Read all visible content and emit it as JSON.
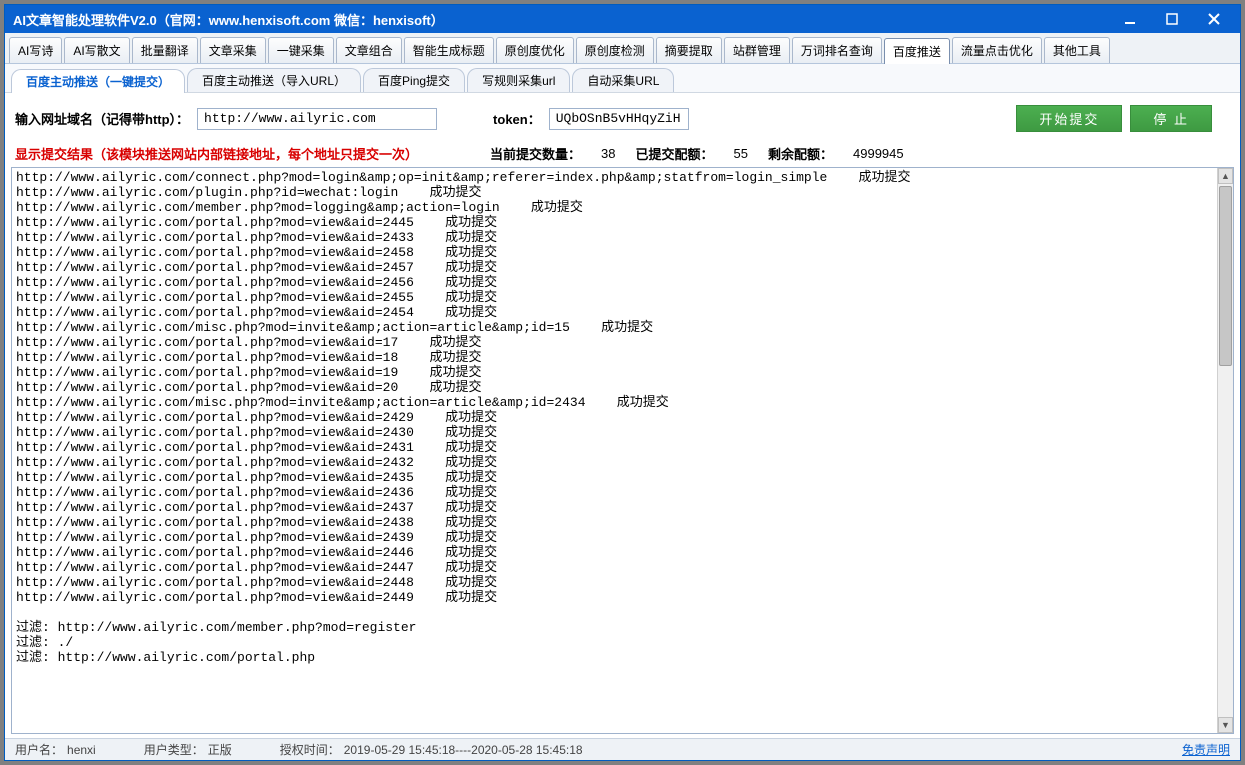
{
  "window": {
    "title": "AI文章智能处理软件V2.0（官网：www.henxisoft.com  微信：henxisoft）"
  },
  "main_tabs": [
    "AI写诗",
    "AI写散文",
    "批量翻译",
    "文章采集",
    "一键采集",
    "文章组合",
    "智能生成标题",
    "原创度优化",
    "原创度检测",
    "摘要提取",
    "站群管理",
    "万词排名查询",
    "百度推送",
    "流量点击优化",
    "其他工具"
  ],
  "main_tab_active": 12,
  "sub_tabs": [
    "百度主动推送（一键提交）",
    "百度主动推送（导入URL）",
    "百度Ping提交",
    "写规则采集url",
    "自动采集URL"
  ],
  "sub_tab_active": 0,
  "form": {
    "domain_label": "输入网址域名（记得带http）：",
    "domain_value": "http://www.ailyric.com",
    "token_label": "token：",
    "token_value": "UQbOSnB5vHHqyZiH",
    "start_btn": "开始提交",
    "stop_btn": "停 止"
  },
  "stats": {
    "result_label": "显示提交结果（该模块推送网站内部链接地址，每个地址只提交一次）",
    "current_label": "当前提交数量：",
    "current_value": "38",
    "submitted_label": "已提交配额：",
    "submitted_value": "55",
    "remain_label": "剩余配额：",
    "remain_value": "4999945"
  },
  "log": {
    "lines": [
      "http://www.ailyric.com/connect.php?mod=login&amp;op=init&amp;referer=index.php&amp;statfrom=login_simple    成功提交",
      "http://www.ailyric.com/plugin.php?id=wechat:login    成功提交",
      "http://www.ailyric.com/member.php?mod=logging&amp;action=login    成功提交",
      "http://www.ailyric.com/portal.php?mod=view&aid=2445    成功提交",
      "http://www.ailyric.com/portal.php?mod=view&aid=2433    成功提交",
      "http://www.ailyric.com/portal.php?mod=view&aid=2458    成功提交",
      "http://www.ailyric.com/portal.php?mod=view&aid=2457    成功提交",
      "http://www.ailyric.com/portal.php?mod=view&aid=2456    成功提交",
      "http://www.ailyric.com/portal.php?mod=view&aid=2455    成功提交",
      "http://www.ailyric.com/portal.php?mod=view&aid=2454    成功提交",
      "http://www.ailyric.com/misc.php?mod=invite&amp;action=article&amp;id=15    成功提交",
      "http://www.ailyric.com/portal.php?mod=view&aid=17    成功提交",
      "http://www.ailyric.com/portal.php?mod=view&aid=18    成功提交",
      "http://www.ailyric.com/portal.php?mod=view&aid=19    成功提交",
      "http://www.ailyric.com/portal.php?mod=view&aid=20    成功提交",
      "http://www.ailyric.com/misc.php?mod=invite&amp;action=article&amp;id=2434    成功提交",
      "http://www.ailyric.com/portal.php?mod=view&aid=2429    成功提交",
      "http://www.ailyric.com/portal.php?mod=view&aid=2430    成功提交",
      "http://www.ailyric.com/portal.php?mod=view&aid=2431    成功提交",
      "http://www.ailyric.com/portal.php?mod=view&aid=2432    成功提交",
      "http://www.ailyric.com/portal.php?mod=view&aid=2435    成功提交",
      "http://www.ailyric.com/portal.php?mod=view&aid=2436    成功提交",
      "http://www.ailyric.com/portal.php?mod=view&aid=2437    成功提交",
      "http://www.ailyric.com/portal.php?mod=view&aid=2438    成功提交",
      "http://www.ailyric.com/portal.php?mod=view&aid=2439    成功提交",
      "http://www.ailyric.com/portal.php?mod=view&aid=2446    成功提交",
      "http://www.ailyric.com/portal.php?mod=view&aid=2447    成功提交",
      "http://www.ailyric.com/portal.php?mod=view&aid=2448    成功提交",
      "http://www.ailyric.com/portal.php?mod=view&aid=2449    成功提交",
      "",
      "过滤: http://www.ailyric.com/member.php?mod=register",
      "过滤: ./",
      "过滤: http://www.ailyric.com/portal.php"
    ]
  },
  "status": {
    "user_label": "用户名：",
    "user_value": "henxi",
    "type_label": "用户类型：",
    "type_value": "正版",
    "auth_label": "授权时间：",
    "auth_value": "2019-05-29 15:45:18----2020-05-28 15:45:18",
    "disclaimer": "免责声明"
  }
}
